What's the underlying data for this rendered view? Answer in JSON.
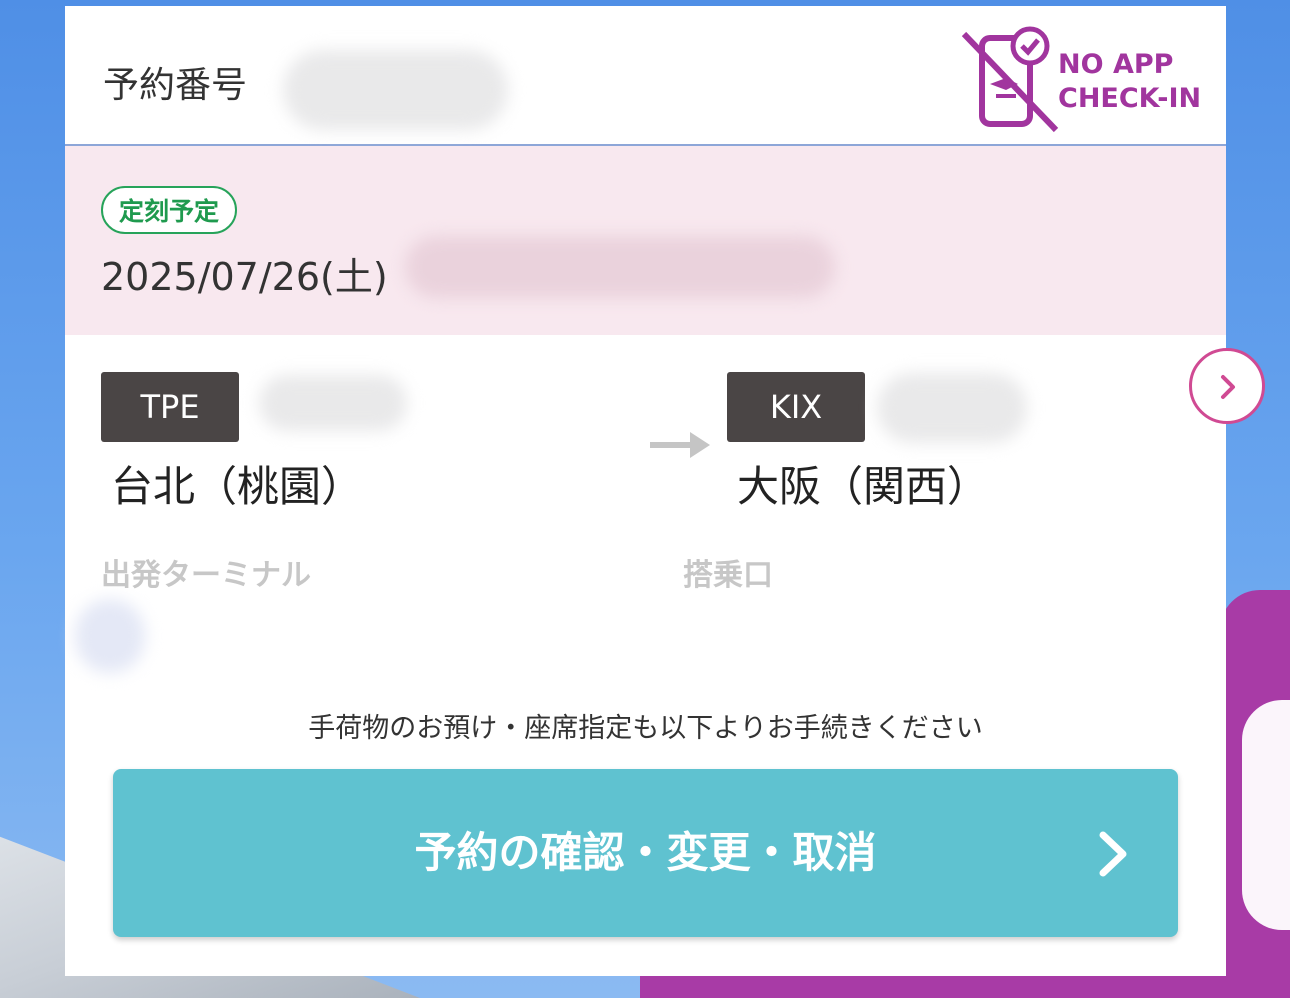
{
  "header": {
    "booking_label": "予約番号",
    "no_app_line1": "NO APP",
    "no_app_line2": "CHECK-IN",
    "icon": "no-app-checkin-icon"
  },
  "status": {
    "badge": "定刻予定",
    "date": "2025/07/26(土)"
  },
  "route": {
    "origin": {
      "code": "TPE",
      "city": "台北（桃園）",
      "sub_label": "出発ターミナル"
    },
    "destination": {
      "code": "KIX",
      "city": "大阪（関西）",
      "sub_label": "搭乗口"
    },
    "arrow_icon": "arrow-right-icon"
  },
  "notice": "手荷物のお預け・座席指定も以下よりお手続きください",
  "manage_button": {
    "label": "予約の確認・変更・取消",
    "icon": "chevron-right-icon"
  },
  "next_button": {
    "icon": "chevron-right-icon"
  },
  "colors": {
    "brand_purple": "#a1359e",
    "status_green": "#27a35a",
    "status_band": "#f8e8ef",
    "button_teal": "#5fc2d0",
    "next_ring": "#d04a93",
    "code_badge": "#4a4545"
  }
}
